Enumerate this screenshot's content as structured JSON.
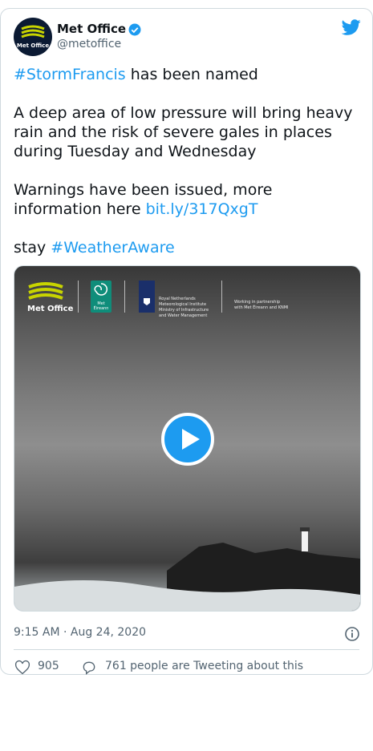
{
  "account": {
    "name": "Met Office",
    "handle": "@metoffice",
    "avatar_label": "Met Office"
  },
  "tweet": {
    "hashtag1": "#StormFrancis",
    "line1_rest": " has been named",
    "para2": "A deep area of low pressure will bring heavy rain and the risk of severe gales in places during Tuesday and Wednesday",
    "para3_prefix": "Warnings have been issued, more information here ",
    "link": "bit.ly/317QxgT",
    "para4_prefix": "stay ",
    "hashtag2": "#WeatherAware"
  },
  "media": {
    "met_office_logo_text": "Met Office",
    "met_eireann_text": "Met Éireann",
    "knmi_text": "Royal Netherlands\nMeteorological Institute\nMinistry of Infrastructure\nand Water Management",
    "partnership_text": "Working in partnership\nwith Met Éireann and KNMI"
  },
  "meta": {
    "timestamp": "9:15 AM · Aug 24, 2020"
  },
  "actions": {
    "likes": "905",
    "tweeting": "761 people are Tweeting about this"
  },
  "icons": {
    "verified": "verified-badge-icon",
    "bird": "twitter-bird-icon",
    "info": "info-icon",
    "heart": "heart-icon",
    "reply": "reply-icon",
    "play": "play-icon"
  },
  "colors": {
    "link": "#1d9bf0",
    "secondary_text": "#536471",
    "border": "#cfd9de"
  }
}
